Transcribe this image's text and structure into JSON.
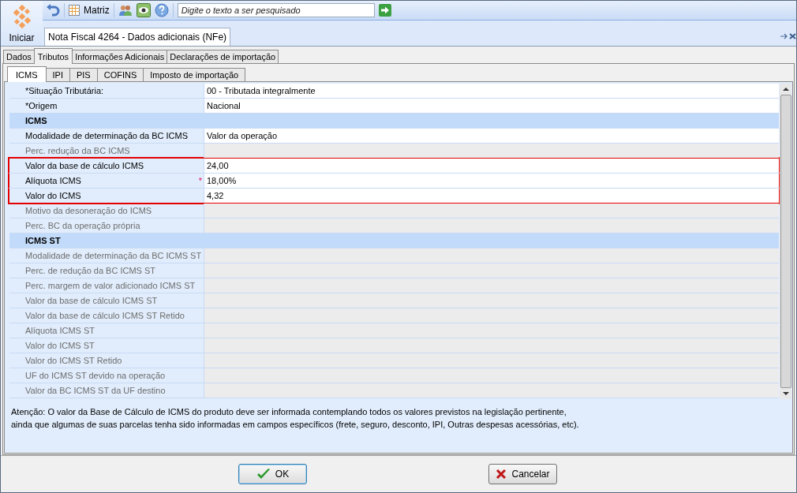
{
  "toolbar": {
    "start_label": "Iniciar",
    "matrix_label": "Matriz",
    "search": {
      "placeholder": "Digite o texto a ser pesquisado"
    }
  },
  "document_tab": {
    "title": "Nota Fiscal 4264 - Dados adicionais (NFe)"
  },
  "tabs": [
    {
      "label": "Dados",
      "selected": false
    },
    {
      "label": "Tributos",
      "selected": true
    },
    {
      "label": "Informações Adicionais",
      "selected": false
    },
    {
      "label": "Declarações de importação",
      "selected": false
    }
  ],
  "subtabs": [
    {
      "label": "ICMS",
      "selected": true
    },
    {
      "label": "IPI",
      "selected": false
    },
    {
      "label": "PIS",
      "selected": false
    },
    {
      "label": "COFINS",
      "selected": false
    },
    {
      "label": "Imposto de importação",
      "selected": false
    }
  ],
  "rows": [
    {
      "kind": "field",
      "label": "*Situação Tributária:",
      "value": "00 - Tributada integralmente",
      "disabled": false,
      "highlighted": false
    },
    {
      "kind": "field",
      "label": "*Origem",
      "value": "Nacional",
      "disabled": false,
      "highlighted": false
    },
    {
      "kind": "section",
      "label": "ICMS"
    },
    {
      "kind": "field",
      "label": "Modalidade de determinação da BC ICMS",
      "value": "Valor da operação",
      "disabled": false,
      "highlighted": false
    },
    {
      "kind": "field",
      "label": "Perc. redução da BC ICMS",
      "disabled": true,
      "highlighted": false
    },
    {
      "kind": "field",
      "label": "Valor da base de cálculo ICMS",
      "value": "24,00",
      "disabled": false,
      "highlighted": true
    },
    {
      "kind": "field",
      "label": "Alíquota ICMS",
      "value": "18,00%",
      "disabled": false,
      "highlighted": true,
      "required_mark": "*"
    },
    {
      "kind": "field",
      "label": "Valor do ICMS",
      "value": "4,32",
      "disabled": false,
      "highlighted": true
    },
    {
      "kind": "field",
      "label": "Motivo da desoneração do ICMS",
      "disabled": true,
      "highlighted": false
    },
    {
      "kind": "field",
      "label": "Perc. BC da operação própria",
      "disabled": true,
      "highlighted": false
    },
    {
      "kind": "section",
      "label": "ICMS ST"
    },
    {
      "kind": "field",
      "label": "Modalidade de determinação da BC ICMS ST",
      "disabled": true,
      "highlighted": false
    },
    {
      "kind": "field",
      "label": "Perc. de redução da BC ICMS ST",
      "disabled": true,
      "highlighted": false
    },
    {
      "kind": "field",
      "label": "Perc. margem de valor adicionado ICMS ST",
      "disabled": true,
      "highlighted": false
    },
    {
      "kind": "field",
      "label": "Valor da base de cálculo ICMS ST",
      "disabled": true,
      "highlighted": false
    },
    {
      "kind": "field",
      "label": "Valor da base de cálculo ICMS ST Retido",
      "disabled": true,
      "highlighted": false
    },
    {
      "kind": "field",
      "label": "Alíquota ICMS ST",
      "disabled": true,
      "highlighted": false
    },
    {
      "kind": "field",
      "label": "Valor do ICMS ST",
      "disabled": true,
      "highlighted": false
    },
    {
      "kind": "field",
      "label": "Valor do ICMS ST Retido",
      "disabled": true,
      "highlighted": false
    },
    {
      "kind": "field",
      "label": "UF do ICMS ST devido na operação",
      "disabled": true,
      "highlighted": false
    },
    {
      "kind": "field",
      "label": "Valor da BC ICMS ST da UF destino",
      "disabled": true,
      "highlighted": false
    }
  ],
  "note": "Atenção: O valor da Base de Cálculo de ICMS do produto deve ser informada contemplando todos os valores previstos na legislação pertinente,\nainda que algumas de suas parcelas tenha sido informadas em campos específicos (frete, seguro, desconto, IPI, Outras despesas acessórias, etc).",
  "buttons": [
    {
      "kind": "ok",
      "label": "OK"
    },
    {
      "kind": "cancel",
      "label": "Cancelar"
    }
  ]
}
